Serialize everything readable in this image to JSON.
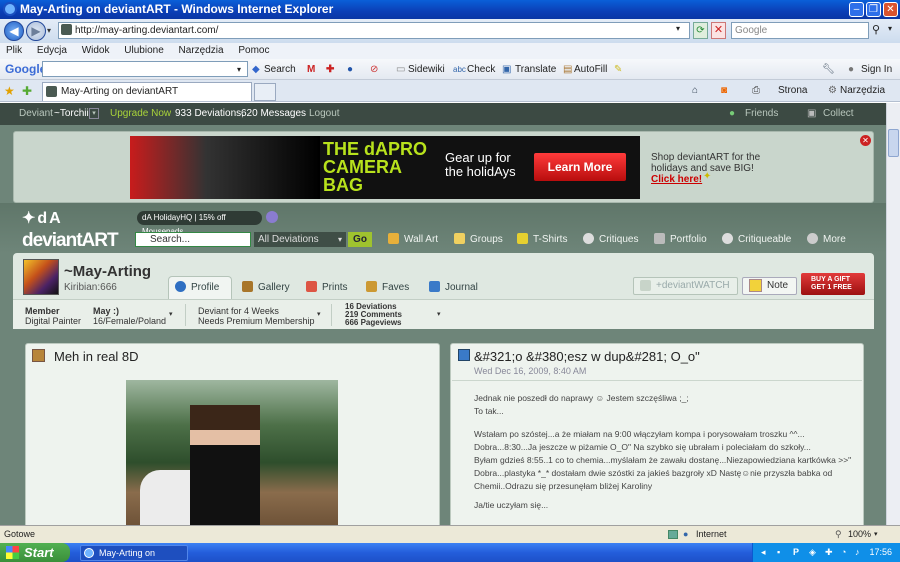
{
  "window": {
    "title": "May-Arting on deviantART - Windows Internet Explorer"
  },
  "addressbar": {
    "url": "http://may-arting.deviantart.com/",
    "search_placeholder": "Google"
  },
  "menu": [
    "Plik",
    "Edycja",
    "Widok",
    "Ulubione",
    "Narzędzia",
    "Pomoc"
  ],
  "google_toolbar": {
    "logo": "Google",
    "search": "Search",
    "sidewiki": "Sidewiki",
    "check": "Check",
    "translate": "Translate",
    "autofill": "AutoFill",
    "signin": "Sign In"
  },
  "tabs": {
    "active": "May-Arting on deviantART",
    "strona": "Strona",
    "narzedzia": "Narzędzia"
  },
  "da_top": {
    "deviant": "Deviant",
    "user": "~Torchii",
    "upgrade": "Upgrade Now",
    "deviations": "933 Deviations,",
    "messages": "620 Messages",
    "logout": "Logout",
    "friends": "Friends",
    "collect": "Collect"
  },
  "ad": {
    "title": "THE dAPRO CAMERA BAG",
    "tagline": "Gear up for the holidAys",
    "cta": "Learn More",
    "shop": "Shop deviantART for the holidays and save BIG!",
    "link": "Click here!"
  },
  "logo": "deviantART",
  "holiday": "dA HolidayHQ | 15% off Mousepads",
  "search": {
    "placeholder": "Search...",
    "scope": "All Deviations",
    "go": "Go"
  },
  "nav": [
    "Wall Art",
    "Groups",
    "T-Shirts",
    "Critiques",
    "Portfolio",
    "Critiqueable",
    "More"
  ],
  "profile": {
    "username": "~May-Arting",
    "realname": "Kiribian:666",
    "tabs": [
      "Profile",
      "Gallery",
      "Prints",
      "Faves",
      "Journal"
    ],
    "watch": "+deviantWATCH",
    "note": "Note",
    "gift": "BUY A GIFT GET 1 FREE"
  },
  "stats": {
    "member_label": "Member",
    "member_value": "Digital Painter",
    "name_label": "May :)",
    "name_value": "16/Female/Poland",
    "deviant_for": "Deviant for 4 Weeks",
    "premium": "Needs Premium Membership",
    "deviations": "16 Deviations",
    "comments": "219 Comments",
    "pageviews": "666 Pageviews"
  },
  "deviation": {
    "title": "Meh in real 8D"
  },
  "journal": {
    "title": "&#321;o &#380;esz w dup&#281; O_o\"",
    "date": "Wed Dec 16, 2009, 8:40 AM",
    "paragraphs": [
      "Jednak nie poszedł do naprawy ☺ Jestem szczęśliwa ;_;",
      "To tak...",
      "Wstałam po szóstej...a że miałam na 9:00 włączyłam kompa i porysowałam troszku ^^...",
      "Dobra...8:30...Ja jeszcze w piżamie O_O\" Na szybko się ubrałam i poleciałam do szkoły...",
      "Byłam gdzieś 8:55..1 co to chemia...myślałam że zawału dostanę...Niezapowiedziana kartkówka >>\"",
      "Dobra...plastyka *_* dostałam dwie szóstki za jakieś bazgroły xD Nastę☺nie przyszła babka od Chemii..Odrazu się przesunęłam bliżej Karoliny",
      "Ja/tie uczyłam się..."
    ]
  },
  "statusbar": {
    "left": "Gotowe",
    "zone": "Internet",
    "zoom": "100%"
  },
  "taskbar": {
    "start": "Start",
    "item": "May-Arting on devian...",
    "clock": "17:56"
  }
}
